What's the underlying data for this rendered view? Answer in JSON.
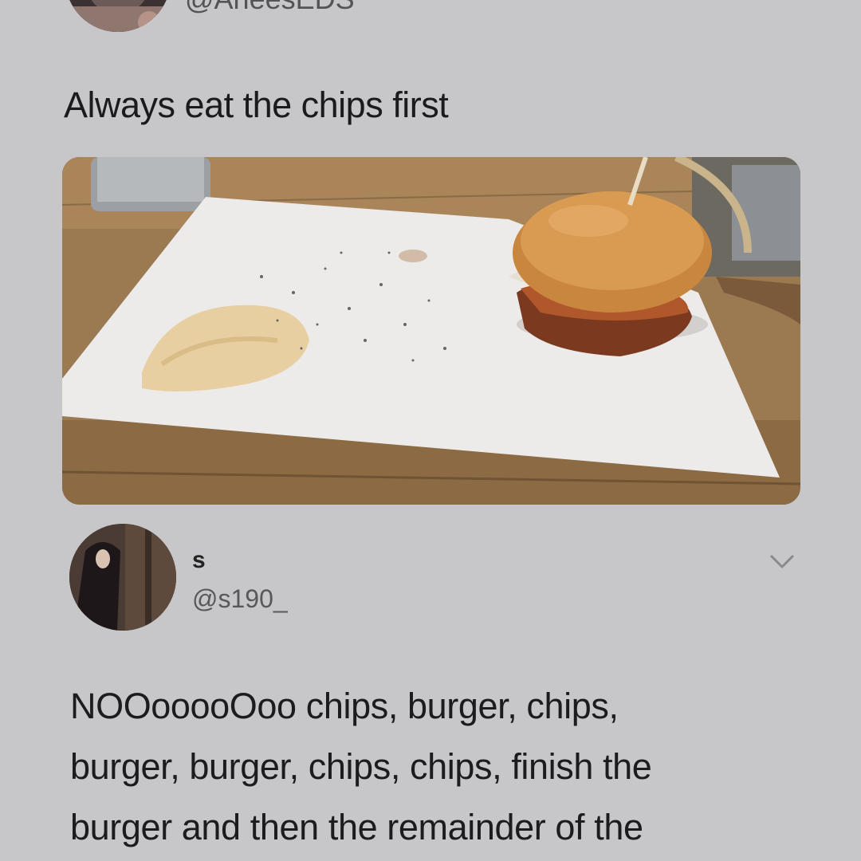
{
  "tweet": {
    "handle": "@AneesEDS",
    "text": "Always eat the chips first",
    "image_alt_icon": "burger-photo"
  },
  "reply": {
    "name": "s",
    "handle": "@s190_",
    "more_icon": "chevron-down-icon",
    "text_lines": [
      "NOOooooOoo chips, burger, chips,",
      "burger, burger, chips, chips, finish the",
      "burger and then the remainder of the"
    ]
  },
  "colors": {
    "background": "#c7c7c9",
    "text": "#1b1b1d",
    "secondary_text": "#58585b"
  }
}
